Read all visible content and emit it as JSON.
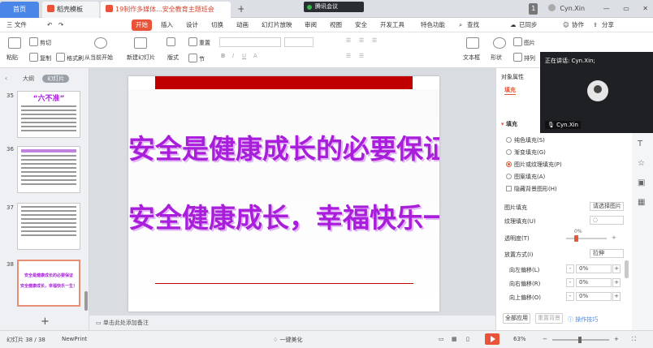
{
  "tabs": {
    "home": "首页",
    "templates": "稻壳模板",
    "document": "19制作多媒体...安全教育主题班会",
    "plus": "+"
  },
  "meeting": {
    "label": "腾讯会议"
  },
  "titlebar": {
    "page_badge": "1",
    "user": "Cyn.Xin"
  },
  "menu": {
    "file": "三 文件",
    "start": "开始",
    "insert": "插入",
    "design": "设计",
    "transition": "切换",
    "animation": "动画",
    "slideshow": "幻灯片放映",
    "review": "审阅",
    "view": "视图",
    "security": "安全",
    "devtools": "开发工具",
    "special": "特色功能",
    "search": "查找",
    "sync": "已同步",
    "collab": "协作",
    "share": "分享"
  },
  "toolbar": {
    "paste": "粘贴",
    "cut": "剪切",
    "copy": "复制",
    "format_painter": "格式刷",
    "from_current": "从当前开始",
    "new_slide": "新建幻灯片",
    "layout": "版式",
    "section": "节",
    "reset": "重置",
    "textbox": "文本框",
    "shape": "形状",
    "arrange": "排列",
    "picture": "图片"
  },
  "left_panel": {
    "outline_tab": "大纲",
    "slides_tab": "幻灯片",
    "slide_numbers": [
      "35",
      "36",
      "37",
      "38"
    ],
    "thumb35_title": "“六不准”",
    "thumb38_lines": [
      "安全是健康成长的必要保证",
      "安全健康成长，幸福快乐一生！"
    ],
    "add": "+"
  },
  "slide": {
    "line1": "安全是健康成长的必要保证",
    "line2": "安全健康成长，幸福快乐一生！"
  },
  "notes": {
    "placeholder": "单击此处添加备注"
  },
  "right_panel": {
    "title": "对象属性",
    "fill_tab": "填充",
    "fill_section": "填充",
    "options": [
      "纯色填充(S)",
      "渐变填充(G)",
      "图片或纹理填充(P)",
      "图案填充(A)"
    ],
    "hide_bg": "隐藏背景图形(H)",
    "picture_fill_label": "图片填充",
    "picture_fill_value": "请选择图片",
    "texture_label": "纹理填充(U)",
    "transparency_label": "透明度(T)",
    "transparency_value": "0%",
    "placement_label": "放置方式(I)",
    "placement_value": "拉伸",
    "offset_left_label": "向左偏移(L)",
    "offset_left_value": "0%",
    "offset_right_label": "向右偏移(R)",
    "offset_right_value": "0%",
    "offset_up_label": "向上偏移(O)",
    "offset_up_value": "0%",
    "apply_all": "全部应用",
    "reset_bg": "重置背景",
    "tips": "操作技巧"
  },
  "video": {
    "speaking": "正在讲话: Cyn.Xin;",
    "name": "Cyn.Xin"
  },
  "status": {
    "slide_count": "幻灯片 38 / 38",
    "theme": "NewPrint",
    "beautify": "一键美化",
    "zoom": "63%"
  },
  "colors": {
    "accent": "#e8533a",
    "slide_text": "#a81edb",
    "slide_band": "#c00000"
  }
}
